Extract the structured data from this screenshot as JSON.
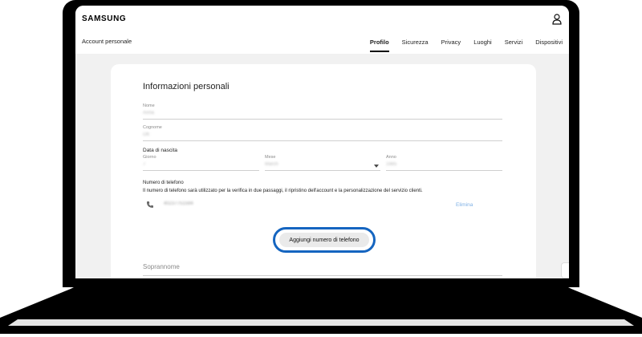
{
  "header": {
    "brand": "SAMSUNG",
    "user_icon": "user-icon"
  },
  "nav": {
    "title": "Account personale",
    "tabs": [
      {
        "label": "Profilo",
        "active": true
      },
      {
        "label": "Sicurezza",
        "active": false
      },
      {
        "label": "Privacy",
        "active": false
      },
      {
        "label": "Luoghi",
        "active": false
      },
      {
        "label": "Servizi",
        "active": false
      },
      {
        "label": "Dispositivi",
        "active": false
      }
    ]
  },
  "form": {
    "title": "Informazioni personali",
    "first_name": {
      "label": "Nome",
      "value": "Anna"
    },
    "last_name": {
      "label": "Cognome",
      "value": "Ott"
    },
    "birth_date": {
      "label": "Data di nascita",
      "day": {
        "label": "Giorno",
        "value": "7"
      },
      "month": {
        "label": "Mese",
        "value": "March"
      },
      "year": {
        "label": "Anno",
        "value": "1985"
      }
    },
    "phone": {
      "label": "Numero di telefono",
      "info": "Il numero di telefono sarà utilizzato per la verifica in due passaggi, il ripristino dell'account e la personalizzazione del servizio clienti.",
      "number": "40237751594",
      "delete_label": "Elimina",
      "add_button_label": "Aggiungi numero di telefono"
    },
    "nickname": {
      "label": "Soprannome"
    }
  },
  "colors": {
    "highlight_ring": "#1565c0",
    "link": "#7fb1e6",
    "page_background": "#f1f1f1"
  }
}
